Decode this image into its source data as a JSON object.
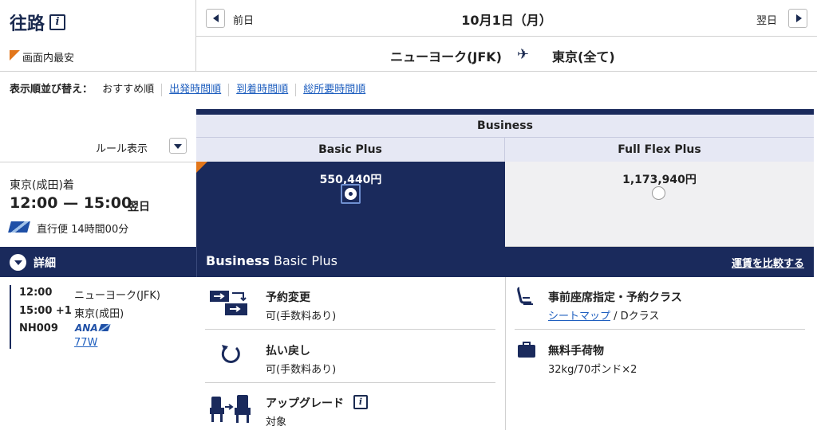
{
  "header": {
    "direction": "往路",
    "cheapest_label": "画面内最安",
    "prev_label": "前日",
    "next_label": "翌日",
    "date": "10月1日（月）",
    "origin": "ニューヨーク(JFK)",
    "destination": "東京(全て)"
  },
  "sort": {
    "label": "表示順並び替え：",
    "options": [
      "おすすめ順",
      "出発時間順",
      "到着時間順",
      "総所要時間順"
    ]
  },
  "fares": {
    "cabin": "Business",
    "columns": [
      {
        "name": "Basic Plus",
        "price": "550,440円",
        "selected": true
      },
      {
        "name": "Full Flex Plus",
        "price": "1,173,940円",
        "selected": false
      }
    ]
  },
  "rules": {
    "label": "ルール表示"
  },
  "flight": {
    "arrival_label": "東京(成田)着",
    "times": "12:00 — 15:00",
    "next_day": "翌日",
    "nonstop": "直行便 14時間00分"
  },
  "detail": {
    "label": "詳細",
    "fare_title_bold": "Business",
    "fare_title_rest": " Basic Plus",
    "compare_link": "運賃を比較する"
  },
  "segment": {
    "dep_time": "12:00",
    "dep_airport": "ニューヨーク(JFK)",
    "arr_time": "15:00 +1",
    "arr_airport": "東京(成田)",
    "flight_no": "NH009",
    "airline_logo": "ANA",
    "aircraft": "77W"
  },
  "features": {
    "change": {
      "title": "予約変更",
      "value": "可(手数料あり)"
    },
    "refund": {
      "title": "払い戻し",
      "value": "可(手数料あり)"
    },
    "upgrade": {
      "title": "アップグレード",
      "value": "対象"
    },
    "seat": {
      "title": "事前座席指定・予約クラス",
      "link": "シートマップ",
      "value": " / Dクラス"
    },
    "baggage": {
      "title": "無料手荷物",
      "value": "32kg/70ポンド×2"
    }
  },
  "colors": {
    "navy": "#1a2a5c",
    "accent": "#e2761b",
    "link": "#1f5fbf",
    "header_bg": "#e6e8f4"
  }
}
